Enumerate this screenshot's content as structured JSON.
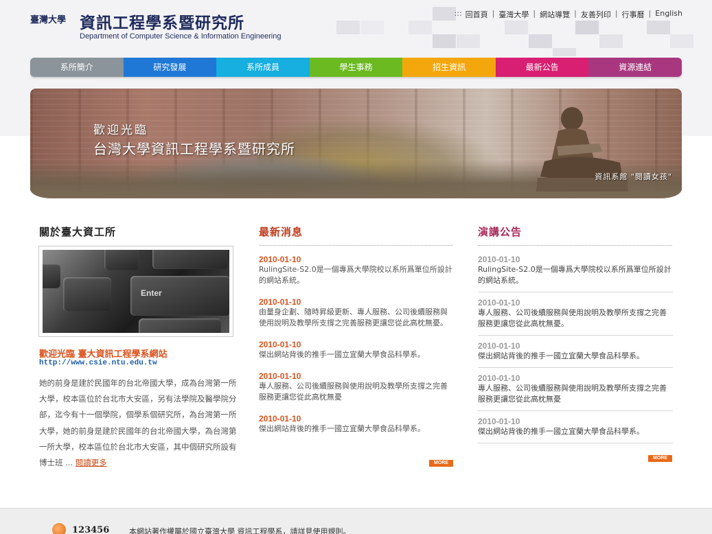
{
  "header": {
    "logo_cn": "臺灣大學",
    "logo_title": "資訊工程學系暨研究所",
    "logo_en": "Department of Computer Science & Information Engineering",
    "top_links_prefix": ":::",
    "top_links": [
      "回首頁",
      "臺灣大學",
      "網站導覽",
      "友善列印",
      "行事曆",
      "English"
    ]
  },
  "nav": {
    "items": [
      {
        "label": "系所簡介",
        "color": "#8a949a"
      },
      {
        "label": "研究發展",
        "color": "#1f78d6"
      },
      {
        "label": "系所成員",
        "color": "#17aee0"
      },
      {
        "label": "學生事務",
        "color": "#6cba22"
      },
      {
        "label": "招生資訊",
        "color": "#f4a70c"
      },
      {
        "label": "最新公告",
        "color": "#d81f72"
      },
      {
        "label": "資源連結",
        "color": "#a8377f"
      }
    ]
  },
  "banner": {
    "welcome_line1": "歡迎光臨",
    "welcome_line2": "台灣大學資訊工程學系暨研究所",
    "caption": "資訊系館 \"閱讀女孩\""
  },
  "about": {
    "title": "關於臺大資工所",
    "photo_key_label": "Enter",
    "headline": "歡迎光臨 臺大資訊工程學系網站",
    "url": "http://www.csie.ntu.edu.tw",
    "body": "她的前身是建於民國年的台北帝國大學，成為台灣第一所大學，校本區位於台北市大安區，另有法學院及醫學院分部，迄今有十一個學院，個學系個研究所，為台灣第一所大學，她的前身是建於民國年的台北帝國大學，為台灣第一所大學，校本區位於台北市大安區，其中個研究所設有博士班 ...",
    "more_link": "閱讀更多"
  },
  "news": {
    "title": "最新消息",
    "items": [
      {
        "date": "2010-01-10",
        "text": "RulingSite-S2.0是一個專爲大學院校以系所爲單位所設計的網站系統。"
      },
      {
        "date": "2010-01-10",
        "text": "由量身企劃、隨時昇級更新、專人服務、公司後續服務與使用說明及教學所支撐之完善服務更讓您從此高枕無憂。"
      },
      {
        "date": "2010-01-10",
        "text": "傑出網站背後的推手一國立宜蘭大學食品科學系。"
      },
      {
        "date": "2010-01-10",
        "text": "專人服務、公司後續服務與使用說明及教學所支撐之完善服務更讓您從此高枕無憂"
      },
      {
        "date": "2010-01-10",
        "text": "傑出網站背後的推手一國立宜蘭大學食品科學系。"
      }
    ],
    "more_label": "MORE"
  },
  "talks": {
    "title": "演講公告",
    "items": [
      {
        "date": "2010-01-10",
        "text": "RulingSite-S2.0是一個專爲大學院校以系所爲單位所設計的網站系統。"
      },
      {
        "date": "2010-01-10",
        "text": "專人服務、公司後續服務與使用說明及教學所支撐之完善服務更讓您從此高枕無憂。"
      },
      {
        "date": "2010-01-10",
        "text": "傑出網站背後的推手一國立宜蘭大學食品科學系。"
      },
      {
        "date": "2010-01-10",
        "text": "專人服務、公司後續服務與使用說明及教學所支撐之完善服務更讓您從此高枕無憂"
      },
      {
        "date": "2010-01-10",
        "text": "傑出網站背後的推手一國立宜蘭大學食品科學系。"
      }
    ],
    "more_label": "MORE"
  },
  "footer": {
    "counter": "123456",
    "copyright": "本網站著作權屬於國立臺灣大學 資訊工程學系，請詳見使用規則。"
  }
}
